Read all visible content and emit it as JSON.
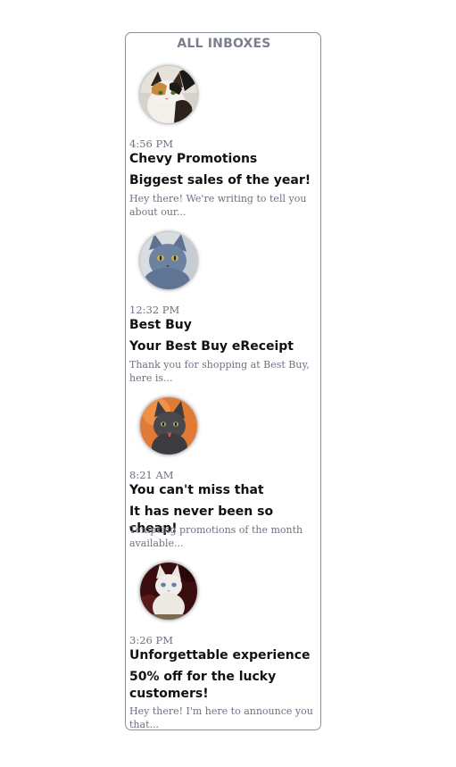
{
  "header": {
    "title": "ALL INBOXES"
  },
  "emails": [
    {
      "avatar": "calico-cat-photo",
      "time": "4:56 PM",
      "sender": "Chevy Promotions",
      "subject": "Biggest sales of the year!",
      "preview": "Hey there! We're writing to tell you about our..."
    },
    {
      "avatar": "gray-blue-cat-photo",
      "time": "12:32 PM",
      "sender": "Best Buy",
      "subject": "Your Best Buy eReceipt",
      "preview": "Thank you for shopping at Best Buy, here is..."
    },
    {
      "avatar": "dark-cat-orange-background-photo",
      "time": "8:21 AM",
      "sender": "You can't miss that",
      "subject": "It has never been so cheap!",
      "preview": "Tempting promotions of the month available..."
    },
    {
      "avatar": "white-kitten-photo",
      "time": "3:26 PM",
      "sender": "Unforgettable experience",
      "subject": "50% off for the lucky customers!",
      "preview": "Hey there! I'm here to announce you that..."
    }
  ]
}
